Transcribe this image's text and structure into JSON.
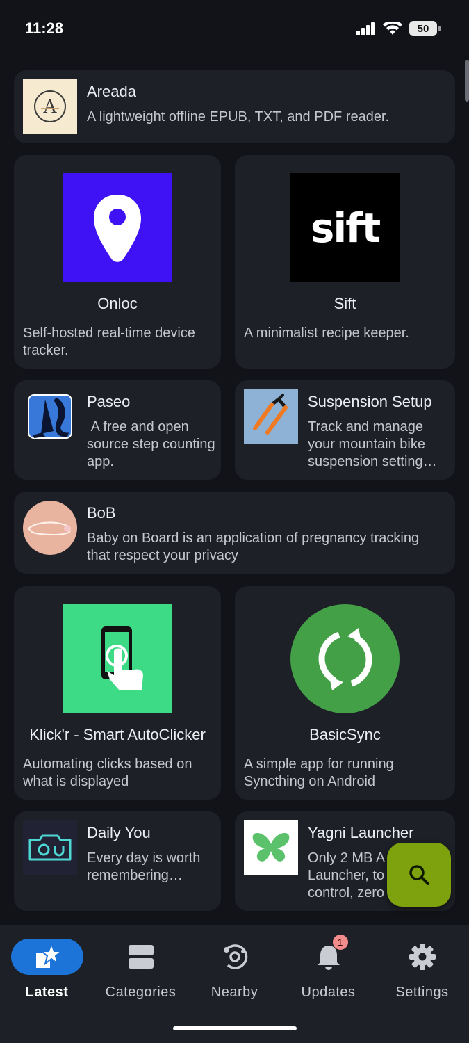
{
  "status_bar": {
    "time": "11:28",
    "battery": "50"
  },
  "apps": {
    "areada": {
      "name": "Areada",
      "description": "A lightweight offline EPUB, TXT, and PDF reader."
    },
    "onloc": {
      "name": "Onloc",
      "description": "Self-hosted real-time device tracker."
    },
    "sift": {
      "name": "Sift",
      "description": "A minimalist recipe keeper.",
      "icon_text": "sift"
    },
    "paseo": {
      "name": "Paseo",
      "description": " A free and open source step counting app."
    },
    "suspension": {
      "name": "Suspension Setup",
      "description": "Track and manage your mountain bike suspension setting…"
    },
    "bob": {
      "name": "BoB",
      "description": "Baby on Board is an application of pregnancy tracking that respect your privacy"
    },
    "klickr": {
      "name": "Klick'r - Smart AutoClicker",
      "description": "Automating clicks based on what is displayed"
    },
    "basicsync": {
      "name": "BasicSync",
      "description": "A simple app for running Syncthing on Android"
    },
    "dailyyou": {
      "name": "Daily You",
      "description": "Every day is worth remembering…"
    },
    "yagni": {
      "name": "Yagni Launcher",
      "description": "Only 2 MB A Launcher, to control, zero"
    }
  },
  "nav": {
    "latest": "Latest",
    "categories": "Categories",
    "nearby": "Nearby",
    "updates": "Updates",
    "updates_badge": "1",
    "settings": "Settings"
  },
  "colors": {
    "accent": "#1c74d9",
    "fab": "#7ea10e",
    "card": "#1d2026",
    "background": "#111318"
  }
}
